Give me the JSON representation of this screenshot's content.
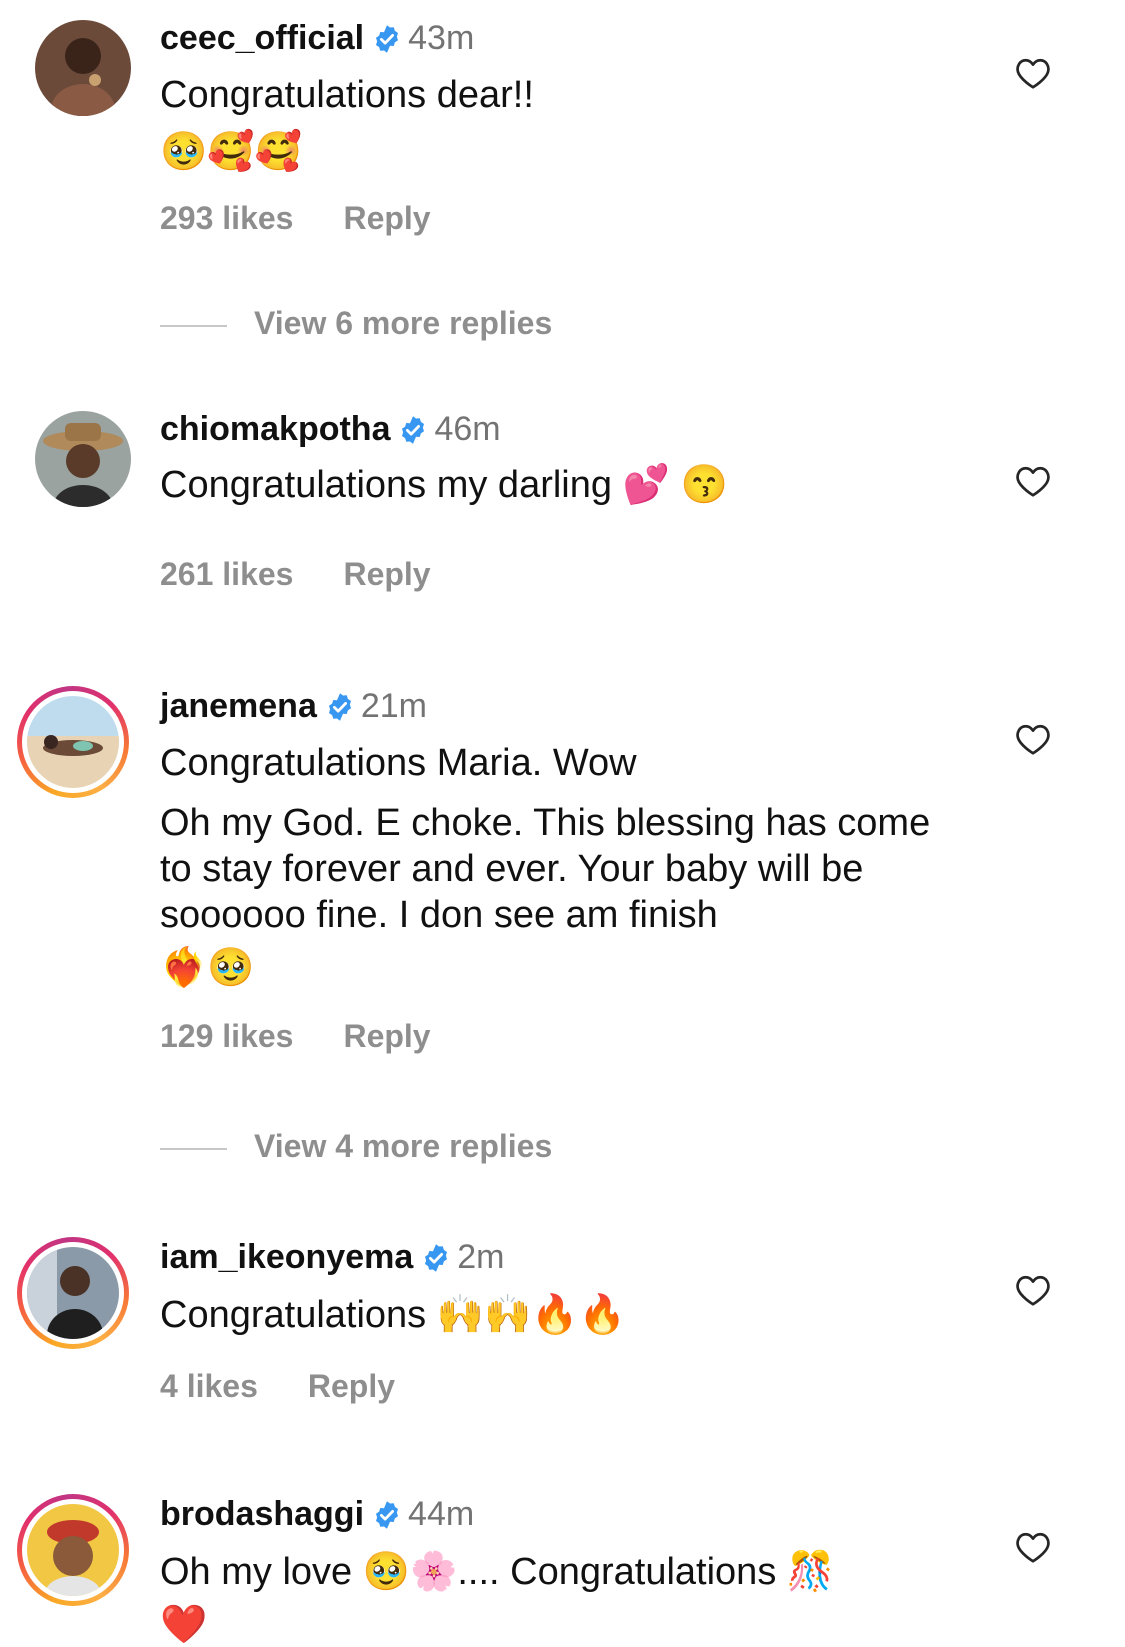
{
  "comments": [
    {
      "username": "ceec_official",
      "time": "43m",
      "text_lines": [
        "Congratulations dear!!",
        "🥹🥰🥰"
      ],
      "likes": "293 likes",
      "reply": "Reply",
      "view_more": "View 6 more replies"
    },
    {
      "username": "chiomakpotha",
      "time": "46m",
      "text_lines": [
        "Congratulations my darling 💕 😙"
      ],
      "likes": "261 likes",
      "reply": "Reply"
    },
    {
      "username": "janemena",
      "time": "21m",
      "text_lines": [
        "Congratulations Maria. Wow",
        "Oh my God. E choke. This blessing has come to stay forever and ever. Your baby will be soooooo fine. I don see am finish",
        "❤️‍🔥🥹"
      ],
      "likes": "129 likes",
      "reply": "Reply",
      "view_more": "View 4 more replies"
    },
    {
      "username": "iam_ikeonyema",
      "time": "2m",
      "text_lines": [
        "Congratulations 🙌🙌🔥🔥"
      ],
      "likes": "4 likes",
      "reply": "Reply"
    },
    {
      "username": "brodashaggi",
      "time": "44m",
      "text_lines": [
        "Oh my love 🥹🌸.... Congratulations 🎊",
        "❤️"
      ]
    }
  ],
  "colors": {
    "verified_badge": "#3897f0",
    "secondary_text": "#8e8e8e",
    "story_ring": "#e1306c"
  },
  "icons": {
    "verified": "verified-badge-icon",
    "like": "heart-outline-icon"
  }
}
